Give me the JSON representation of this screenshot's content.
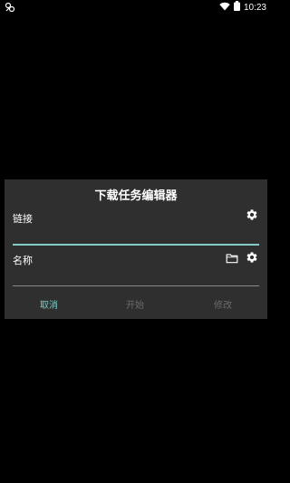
{
  "status_bar": {
    "time": "10:23",
    "icons": [
      "app-notification-icon",
      "wifi-icon",
      "battery-icon"
    ]
  },
  "dialog": {
    "title": "下载任务编辑器",
    "link_field": {
      "label": "链接",
      "value": "",
      "placeholder": "",
      "settings_icon": "gear-icon"
    },
    "name_field": {
      "label": "名称",
      "value": "",
      "placeholder": "",
      "folder_icon": "folder-icon",
      "settings_icon": "gear-icon"
    },
    "actions": {
      "cancel": "取消",
      "start": "开始",
      "modify": "修改"
    }
  },
  "colors": {
    "background": "#000000",
    "dialog_bg": "#2f2f2f",
    "accent": "#80cbc4",
    "disabled_text": "#6b6b6b",
    "underline_inactive": "#8a8a8a"
  }
}
